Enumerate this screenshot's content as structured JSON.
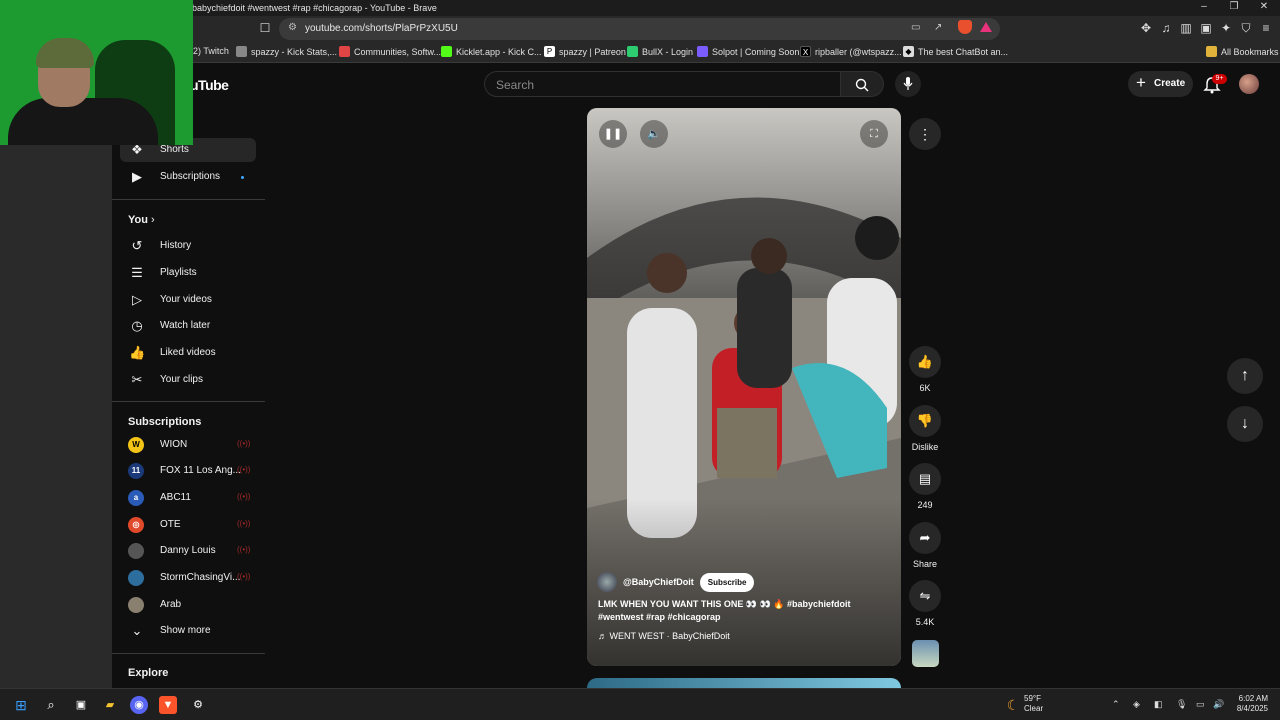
{
  "window": {
    "title": "babychiefdoit #wentwest #rap #chicagorap - YouTube - Brave"
  },
  "browser": {
    "url": "youtube.com/shorts/PlaPrPzXU5U",
    "bookmarks": [
      {
        "label": "2) Twitch",
        "color": "#9146ff"
      },
      {
        "label": "spazzy - Kick Stats,...",
        "color": "#888888"
      },
      {
        "label": "Communities, Softw...",
        "color": "#e04444"
      },
      {
        "label": "Kicklet.app - Kick C...",
        "color": "#53fc18"
      },
      {
        "label": "spazzy | Patreon",
        "color": "#ffffff"
      },
      {
        "label": "BullX - Login",
        "color": "#2ecc71"
      },
      {
        "label": "Solpot | Coming Soon",
        "color": "#7b5cff"
      },
      {
        "label": "ripballer (@wtspazz...",
        "color": "#000000"
      },
      {
        "label": "The best ChatBot an...",
        "color": "#dddddd"
      }
    ],
    "all_bookmarks": "All Bookmarks"
  },
  "youtube": {
    "logo": "uTube",
    "search_placeholder": "Search",
    "create_label": "Create",
    "notif_count": "9+"
  },
  "sidebar": {
    "main": [
      {
        "label": "Shorts",
        "icon": "shorts-icon",
        "active": true
      },
      {
        "label": "Subscriptions",
        "icon": "subscriptions-icon"
      }
    ],
    "you_title": "You",
    "you_items": [
      {
        "label": "History",
        "icon": "history-icon"
      },
      {
        "label": "Playlists",
        "icon": "playlists-icon"
      },
      {
        "label": "Your videos",
        "icon": "your-videos-icon"
      },
      {
        "label": "Watch later",
        "icon": "watch-later-icon"
      },
      {
        "label": "Liked videos",
        "icon": "liked-videos-icon"
      },
      {
        "label": "Your clips",
        "icon": "clips-icon"
      }
    ],
    "subs_title": "Subscriptions",
    "subscriptions": [
      {
        "label": "WION",
        "color": "#f2c418"
      },
      {
        "label": "FOX 11 Los Ang...",
        "color": "#1a3a7a"
      },
      {
        "label": "ABC11",
        "color": "#2a5bb8"
      },
      {
        "label": "OTE",
        "color": "#e04a2a"
      },
      {
        "label": "Danny Louis",
        "color": "#555555"
      },
      {
        "label": "StormChasingVi...",
        "color": "#2e6e9e"
      },
      {
        "label": "Arab",
        "color": "#8a8070"
      }
    ],
    "show_more": "Show more",
    "explore_title": "Explore"
  },
  "short": {
    "channel": "@BabyChiefDoit",
    "subscribe": "Subscribe",
    "caption_text": "LMK WHEN YOU WANT THIS ONE 👀 👀 🔥 ",
    "caption_tags": "#babychiefdoit #wentwest #rap #chicagorap",
    "music": "WENT WEST · BabyChiefDoit",
    "likes": "6K",
    "dislike": "Dislike",
    "comments": "249",
    "share": "Share",
    "remix": "5.4K"
  },
  "taskbar": {
    "temp": "59°F",
    "condition": "Clear",
    "time": "6:02 AM",
    "date": "8/4/2025"
  }
}
